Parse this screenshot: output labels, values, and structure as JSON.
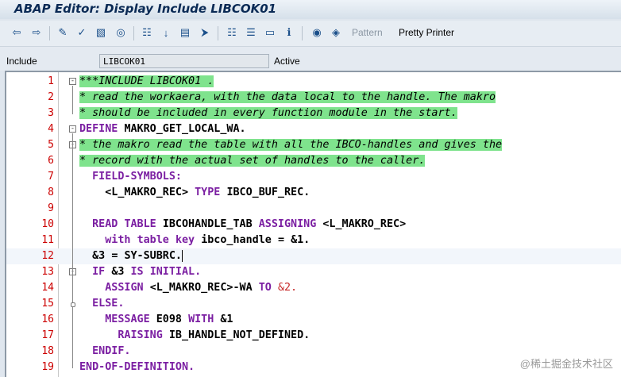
{
  "window": {
    "title": "ABAP Editor: Display Include LIBCOK01"
  },
  "toolbar": {
    "pattern_label": "Pattern",
    "pretty_printer_label": "Pretty Printer"
  },
  "info": {
    "include_label": "Include",
    "include_value": "LIBCOK01",
    "status": "Active"
  },
  "editor": {
    "lines": [
      {
        "n": "1",
        "t": "***INCLUDE LIBCOK01 ."
      },
      {
        "n": "2",
        "t": "* read the workaera, with the data local to the handle. The makro"
      },
      {
        "n": "3",
        "t": "* should be included in every function module in the start."
      },
      {
        "n": "4",
        "t": "DEFINE MAKRO_GET_LOCAL_WA."
      },
      {
        "n": "5",
        "t": "* the makro read the table with all the IBCO-handles and gives the"
      },
      {
        "n": "6",
        "t": "* record with the actual set of handles to the caller."
      },
      {
        "n": "7",
        "t": "  FIELD-SYMBOLS:"
      },
      {
        "n": "8",
        "t": "    <L_MAKRO_REC> TYPE IBCO_BUF_REC."
      },
      {
        "n": "9",
        "t": ""
      },
      {
        "n": "10",
        "t": "  READ TABLE IBCOHANDLE_TAB ASSIGNING <L_MAKRO_REC>"
      },
      {
        "n": "11",
        "t": "    with table key ibco_handle = &1."
      },
      {
        "n": "12",
        "t": "  &3 = SY-SUBRC."
      },
      {
        "n": "13",
        "t": "  IF &3 IS INITIAL."
      },
      {
        "n": "14",
        "t": "    ASSIGN <L_MAKRO_REC>-WA TO &2."
      },
      {
        "n": "15",
        "t": "  ELSE."
      },
      {
        "n": "16",
        "t": "    MESSAGE E098 WITH &1"
      },
      {
        "n": "17",
        "t": "      RAISING IB_HANDLE_NOT_DEFINED."
      },
      {
        "n": "18",
        "t": "  ENDIF."
      },
      {
        "n": "19",
        "t": "END-OF-DEFINITION."
      }
    ]
  },
  "watermark": "@稀土掘金技术社区"
}
